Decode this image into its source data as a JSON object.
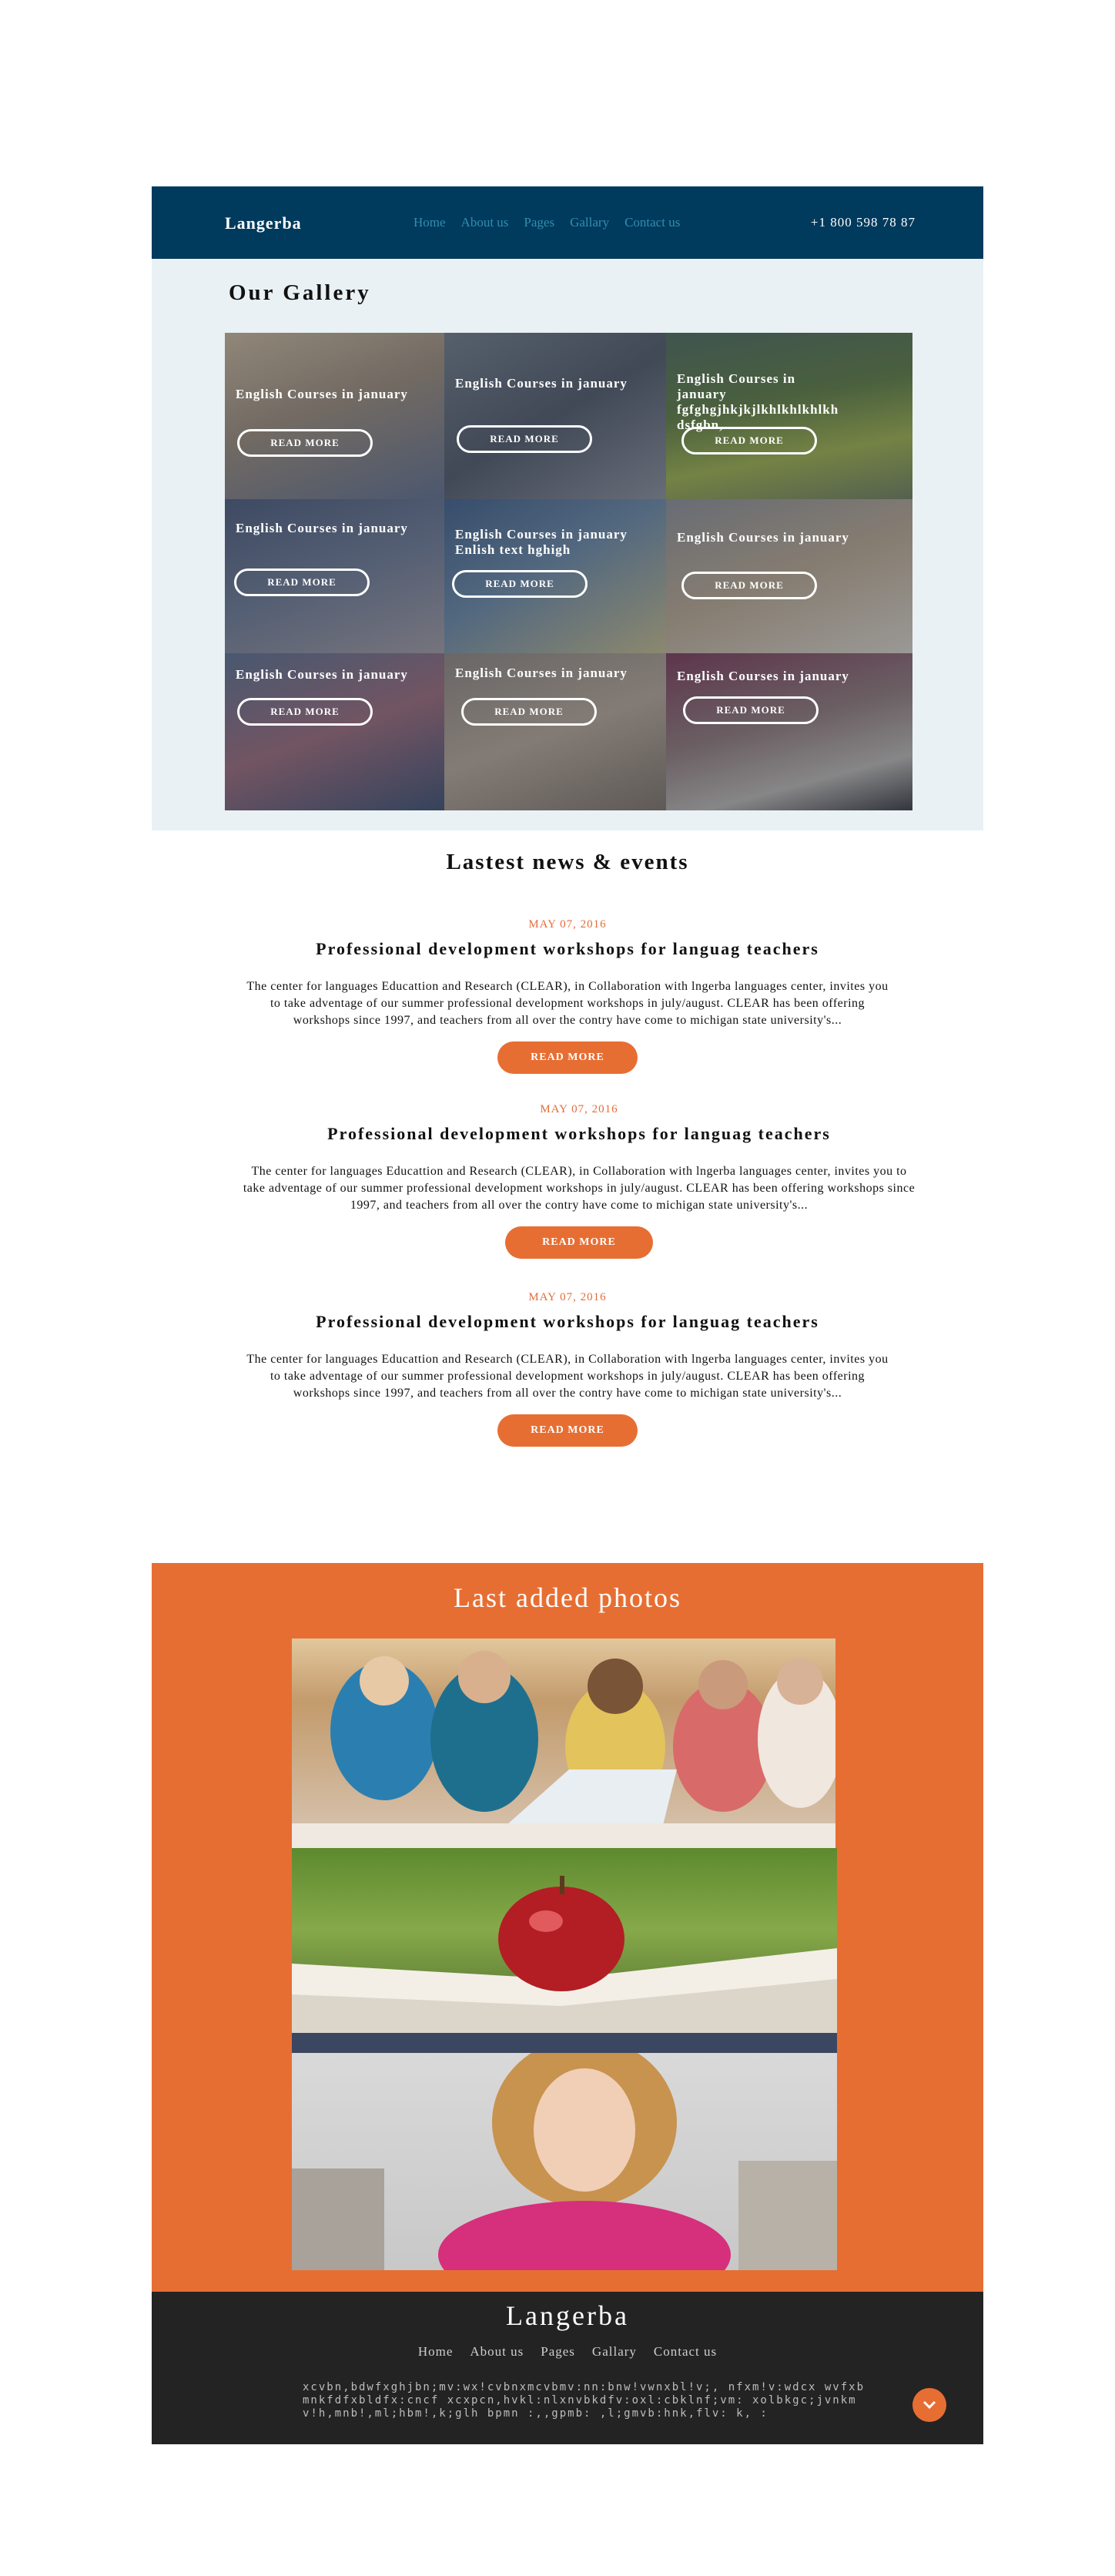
{
  "header": {
    "brand": "Langerba",
    "nav": [
      "Home",
      "About us",
      "Pages",
      "Gallary",
      "Contact us"
    ],
    "phone": "+1 800 598 78 87"
  },
  "gallery": {
    "title": "Our Gallery",
    "items": [
      {
        "title": "English Courses in january",
        "button": "READ MORE"
      },
      {
        "title": "English Courses in january",
        "button": "READ MORE"
      },
      {
        "title": "English Courses in january fgfghgjhkjkjlkhlkhlkhlkh dsfgbn,",
        "button": "READ MORE"
      },
      {
        "title": "English Courses in january",
        "button": "READ MORE"
      },
      {
        "title": "English Courses in january Enlish text hghigh",
        "button": "READ MORE"
      },
      {
        "title": "English Courses in january",
        "button": "READ MORE"
      },
      {
        "title": "English Courses in january",
        "button": "READ MORE"
      },
      {
        "title": "English Courses in january",
        "button": "READ MORE"
      },
      {
        "title": "English Courses in january",
        "button": "READ MORE"
      }
    ]
  },
  "news": {
    "title": "Lastest news & events",
    "items": [
      {
        "date": "MAY 07, 2016",
        "title": "Professional development workshops for languag teachers",
        "text": "The center  for languages Educattion  and Research (CLEAR), in Collaboration with lngerba languages center, invites you to take adventage of our summer professional development  workshops in july/august. CLEAR has been  offering workshops since 1997, and teachers from all over  the contry have come to michigan state university's...",
        "button": "READ MORE"
      },
      {
        "date": "MAY 07, 2016",
        "title": "Professional development workshops for languag teachers",
        "text": "The center  for languages Educattion  and Research (CLEAR), in Collaboration with lngerba languages center, invites you to take adventage of our summer professional development  workshops in july/august. CLEAR has been  offering workshops since 1997, and teachers from all over  the contry have come to michigan state university's...",
        "button": "READ MORE"
      },
      {
        "date": "MAY 07, 2016",
        "title": "Professional development workshops for languag teachers",
        "text": "The center  for languages Educattion  and Research (CLEAR), in Collaboration with lngerba languages center, invites you to take adventage of our summer professional development  workshops in july/august. CLEAR has been  offering workshops since 1997, and teachers from all over  the contry have come to michigan state university's...",
        "button": "READ MORE"
      }
    ]
  },
  "photos": {
    "title": "Last added photos"
  },
  "footer": {
    "brand": "Langerba",
    "nav": [
      "Home",
      "About us",
      "Pages",
      "Gallary",
      "Contact us"
    ],
    "text": "xcvbn,bdwfxghjbn;mv:wx!cvbnxmcvbmv:nn:bnw!vwnxbl!v;, nfxm!v:wdcx wvfxbmnkfdfxbldfx:cncf xcxpcn,hvkl:nlxnvbkdfv:oxl:cbklnf;vm: xolbkgc;jvnkmv!h,mnb!,ml;hbm!,k;glh bpmn :,,gpmb: ,l;gmvb:hnk,flv: k, :",
    "up_icon": "chevron-up-icon"
  },
  "colors": {
    "header": "#003a5d",
    "gallery_bg": "#e9f1f4",
    "accent": "#e76e32",
    "footer": "#232323"
  }
}
